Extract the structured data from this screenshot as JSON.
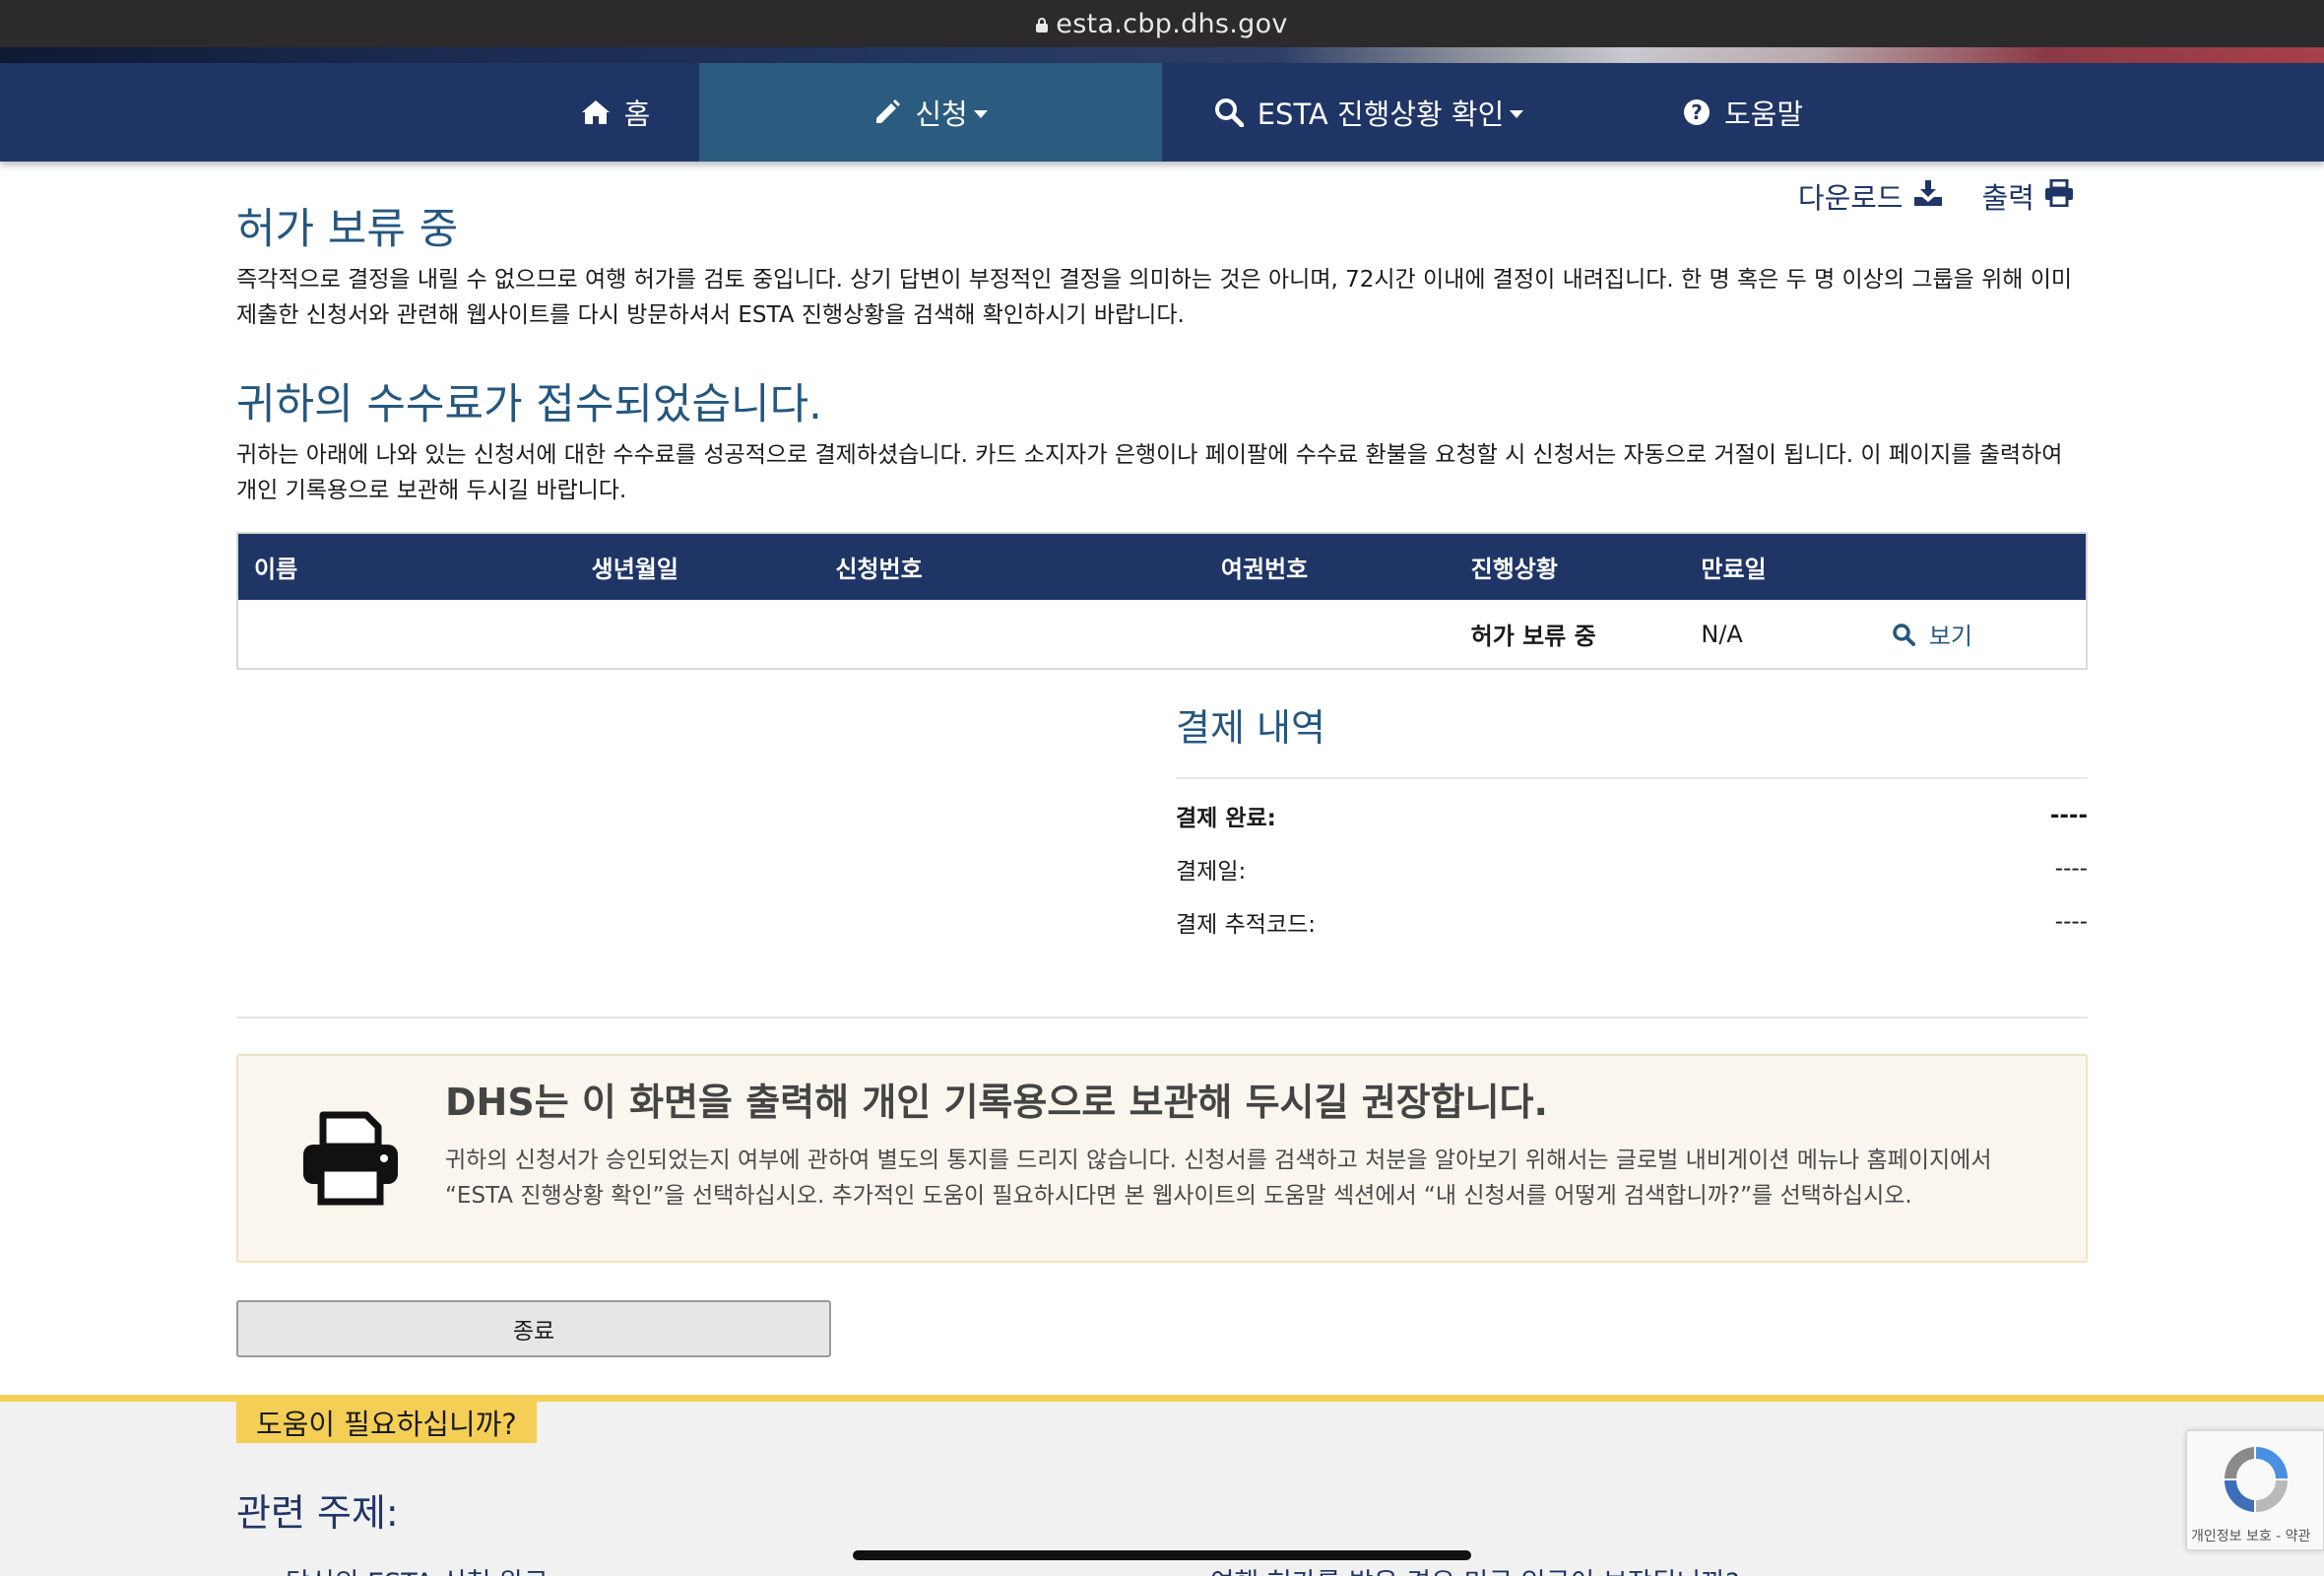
{
  "browser": {
    "url": "esta.cbp.dhs.gov"
  },
  "nav": {
    "items": [
      {
        "label": "홈",
        "icon": "home-icon"
      },
      {
        "label": "신청",
        "icon": "pencil-icon",
        "dropdown": true,
        "active": true
      },
      {
        "label": "ESTA 진행상황 확인",
        "icon": "search-icon",
        "dropdown": true
      },
      {
        "label": "도움말",
        "icon": "question-circle-icon"
      }
    ]
  },
  "toolbar": {
    "download_label": "다운로드",
    "print_label": "출력"
  },
  "status": {
    "title": "허가 보류 중",
    "description": "즉각적으로 결정을 내릴 수 없으므로 여행 허가를 검토 중입니다. 상기 답변이 부정적인 결정을 의미하는 것은 아니며, 72시간 이내에 결정이 내려집니다. 한 명 혹은 두 명 이상의 그룹을 위해 이미 제출한 신청서와 관련해 웹사이트를 다시 방문하셔서 ESTA 진행상황을 검색해 확인하시기 바랍니다."
  },
  "fee": {
    "title": "귀하의 수수료가 접수되었습니다.",
    "description": "귀하는 아래에 나와 있는 신청서에 대한 수수료를 성공적으로 결제하셨습니다. 카드 소지자가 은행이나 페이팔에 수수료 환불을 요청할 시 신청서는 자동으로 거절이 됩니다. 이 페이지를 출력하여 개인 기록용으로 보관해 두시길 바랍니다."
  },
  "table": {
    "headers": [
      "이름",
      "생년월일",
      "신청번호",
      "여권번호",
      "진행상황",
      "만료일"
    ],
    "rows": [
      {
        "name": "",
        "dob": "",
        "app_no": "",
        "passport": "",
        "status": "허가 보류 중",
        "expiry": "N/A",
        "view": "보기"
      }
    ]
  },
  "payment": {
    "title": "결제 내역",
    "rows": [
      {
        "label": "결제 완료:",
        "value": "----"
      },
      {
        "label": "결제일:",
        "value": "----"
      },
      {
        "label": "결제 추적코드:",
        "value": "----"
      }
    ]
  },
  "notice": {
    "title": "DHS는 이 화면을 출력해 개인 기록용으로 보관해 두시길 권장합니다.",
    "body": "귀하의 신청서가 승인되었는지 여부에 관하여 별도의 통지를 드리지 않습니다. 신청서를 검색하고 처분을 알아보기 위해서는 글로벌 내비게이션 메뉴나 홈페이지에서 “ESTA 진행상황 확인”을 선택하십시오. 추가적인 도움이 필요하시다면 본 웹사이트의 도움말 섹션에서 “내 신청서를 어떻게 검색합니까?”를 선택하십시오."
  },
  "close_label": "종료",
  "help": {
    "tag": "도움이 필요하십니까?",
    "related_title": "관련 주제:",
    "links": [
      "당신의 ESTA 신청 완료",
      "여행 허가를 받은 경우 미국 입국이 보장됩니까?"
    ]
  },
  "recaptcha": {
    "text": "개인정보 보호 - 약관"
  },
  "colors": {
    "nav": "#1f3566",
    "nav_active": "#2b5b7f",
    "heading": "#25577f",
    "help_accent": "#f5cf55",
    "notice_bg": "#faf6ed"
  }
}
